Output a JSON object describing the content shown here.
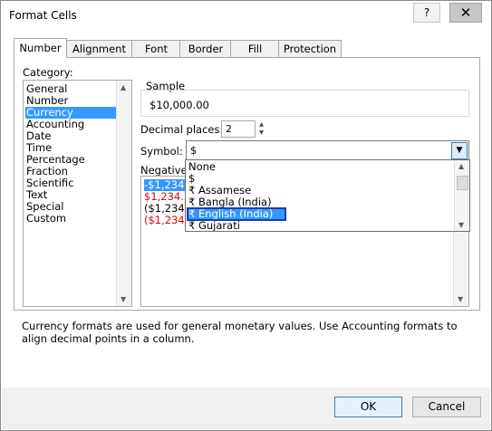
{
  "window": {
    "title": "Format Cells",
    "help_label": "?",
    "close_label": "✕"
  },
  "tabs": [
    "Number",
    "Alignment",
    "Font",
    "Border",
    "Fill",
    "Protection"
  ],
  "category": {
    "label": "Category:",
    "items": [
      "General",
      "Number",
      "Currency",
      "Accounting",
      "Date",
      "Time",
      "Percentage",
      "Fraction",
      "Scientific",
      "Text",
      "Special",
      "Custom"
    ],
    "selected": "Currency"
  },
  "sample": {
    "label": "Sample",
    "value": "$10,000.00"
  },
  "decimal_places": {
    "label": "Decimal places:",
    "value": "2"
  },
  "symbol": {
    "label": "Symbol:",
    "value": "$"
  },
  "negative_numbers": {
    "label": "Negative",
    "items": [
      "-$1,234.1",
      "$1,234.10",
      "($1,234.1",
      "($1,234.1"
    ],
    "colors": [
      "selected",
      "red",
      "black",
      "red"
    ]
  },
  "symbol_dropdown": {
    "items": [
      "None",
      "$",
      "₹ Assamese",
      "₹ Bangla (India)",
      "₹ English (India)",
      "₹ Gujarati"
    ],
    "selected": "₹ English (India)"
  },
  "description": "Currency formats are used for general monetary values.  Use Accounting formats to align decimal points in a column.",
  "buttons": {
    "ok": "OK",
    "cancel": "Cancel"
  },
  "colors": {
    "selection": "#3399ff",
    "negative_red": "#e00000",
    "accent_border": "#1a3fa8"
  }
}
